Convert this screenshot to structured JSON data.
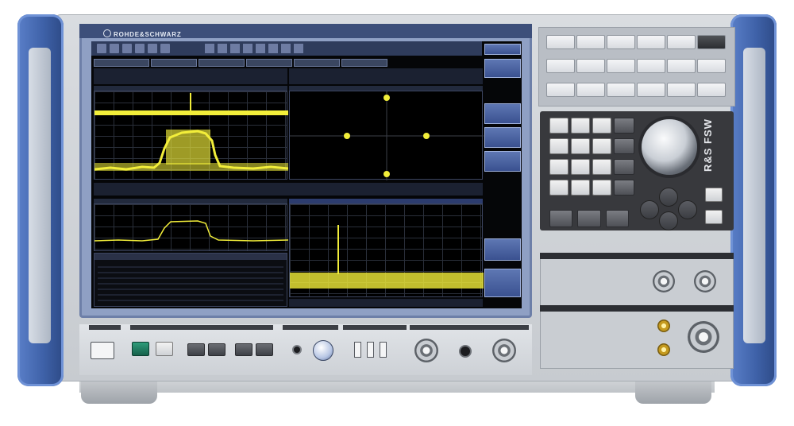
{
  "brand_text": "ROHDE&SCHWARZ",
  "model_text": "R&S FSW",
  "colors": {
    "chassis": "#cfd3d8",
    "handle_blue": "#3f62a9",
    "trace_yellow": "#f2ee3a",
    "screen_bg": "#050608",
    "softkey_blue": "#4a62a1"
  }
}
